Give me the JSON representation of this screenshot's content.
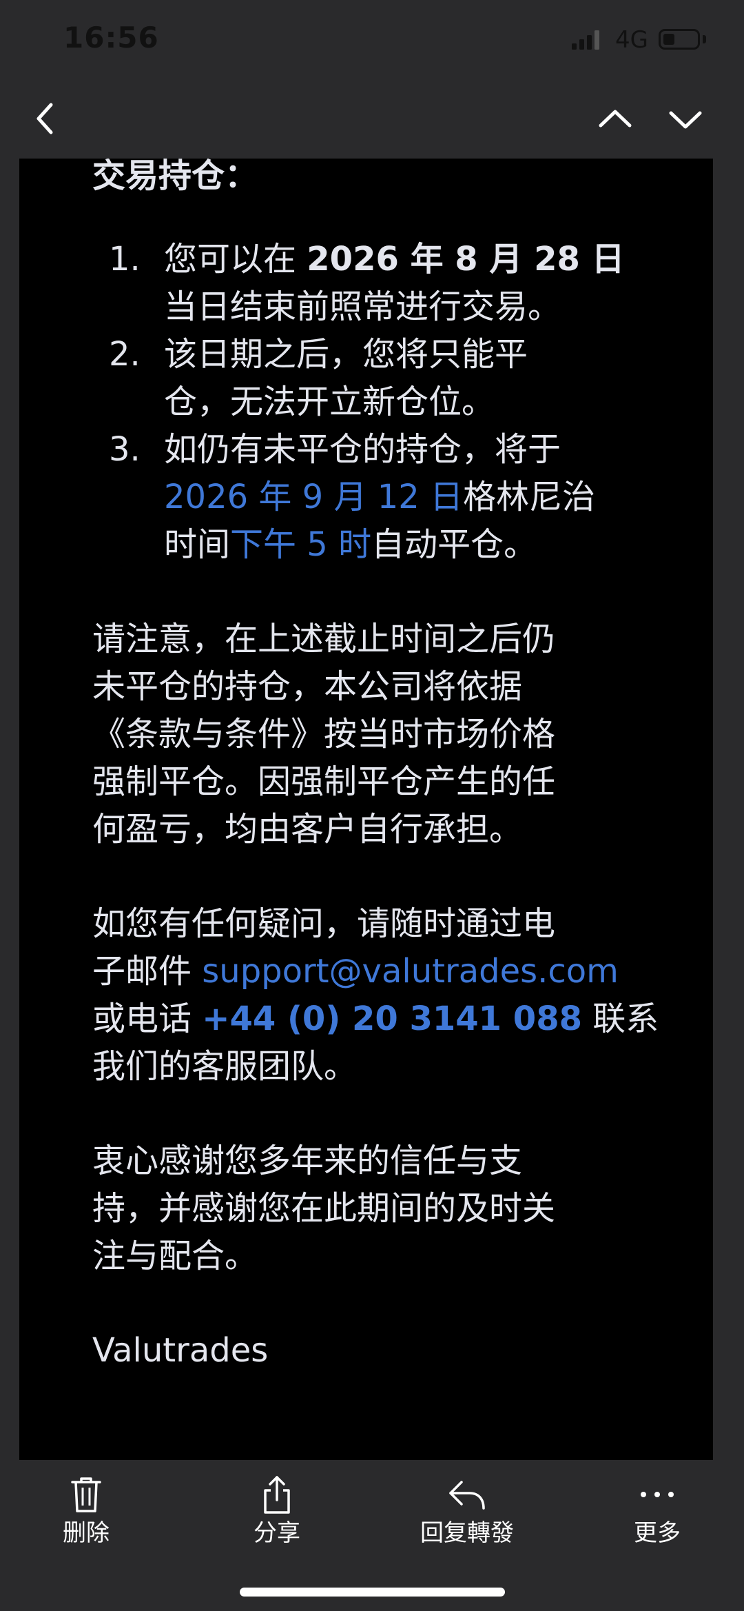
{
  "status": {
    "time": "16:56",
    "network": "4G"
  },
  "nav": {
    "back_icon": "chevron-left-icon",
    "prev_icon": "chevron-up-icon",
    "next_icon": "chevron-down-icon"
  },
  "email": {
    "heading": "交易持仓：",
    "items": [
      {
        "num": "1.",
        "pre": "您可以在 ",
        "date": "2026 年 8 月 28 日",
        "line2": "当日结束前照常进行交易。"
      },
      {
        "num": "2.",
        "line1": "该日期之后，您将只能平",
        "line2": "仓，无法开立新仓位。"
      },
      {
        "num": "3.",
        "line1": "如仍有未平仓的持仓，将于",
        "date": "2026 年 9 月 12 日",
        "date_suffix": "格林尼治",
        "time_pre": "时间",
        "time": "下午 5 时",
        "time_suffix": "自动平仓。"
      }
    ],
    "notice": [
      "请注意，在上述截止时间之后仍",
      "未平仓的持仓，本公司将依据",
      "《条款与条件》按当时市场价格",
      "强制平仓。因强制平仓产生的任",
      "何盈亏，均由客户自行承担。"
    ],
    "contact": {
      "line1": "如您有任何疑问，请随时通过电",
      "email_pre": "子邮件 ",
      "email": "support@valutrades.com",
      "phone_pre": "或电话 ",
      "phone": "+44 (0) 20 3141 088",
      "phone_suffix": " 联系",
      "line4": "我们的客服团队。"
    },
    "thanks": [
      "衷心感谢您多年来的信任与支",
      "持，并感谢您在此期间的及时关",
      "注与配合。"
    ],
    "signature": "Valutrades"
  },
  "toolbar": {
    "delete": "删除",
    "share": "分享",
    "reply": "回复轉發",
    "more": "更多"
  },
  "colors": {
    "background": "#2a2a2c",
    "content": "#000000",
    "link": "#3f78d8",
    "text": "#e4e6ee"
  }
}
